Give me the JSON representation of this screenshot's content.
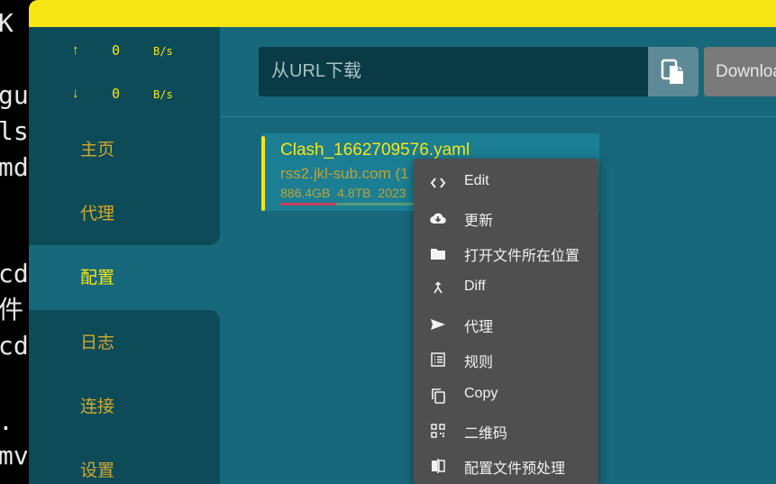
{
  "terminal": {
    "lines": [
      "K",
      "gu",
      "ls",
      "md",
      "",
      "cd",
      "件",
      "cd",
      "",
      ".",
      "mv"
    ]
  },
  "traffic": {
    "upload_arrow": "↑",
    "upload_value": "0",
    "upload_unit": "B/s",
    "download_arrow": "↓",
    "download_value": "0",
    "download_unit": "B/s"
  },
  "nav": {
    "home": "主页",
    "proxy": "代理",
    "profiles": "配置",
    "logs": "日志",
    "connections": "连接",
    "settings": "设置"
  },
  "toolbar": {
    "url_placeholder": "从URL下载",
    "download_label": "Download"
  },
  "profile": {
    "name": "Clash_1662709576.yaml",
    "url": "rss2.jkl-sub.com (1",
    "used": "886.4GB",
    "total": "4.8TB",
    "date": "2023",
    "usage_fraction": 0.18
  },
  "context_menu": {
    "items": [
      "Edit",
      "更新",
      "打开文件所在位置",
      "Diff",
      "代理",
      "规则",
      "Copy",
      "二维码",
      "配置文件预处理"
    ]
  },
  "colors": {
    "accent_yellow": "#f7e613",
    "sidebar_dark": "#0d4b58",
    "main_bg": "#17687a",
    "menu_bg": "#4f4f4f"
  }
}
